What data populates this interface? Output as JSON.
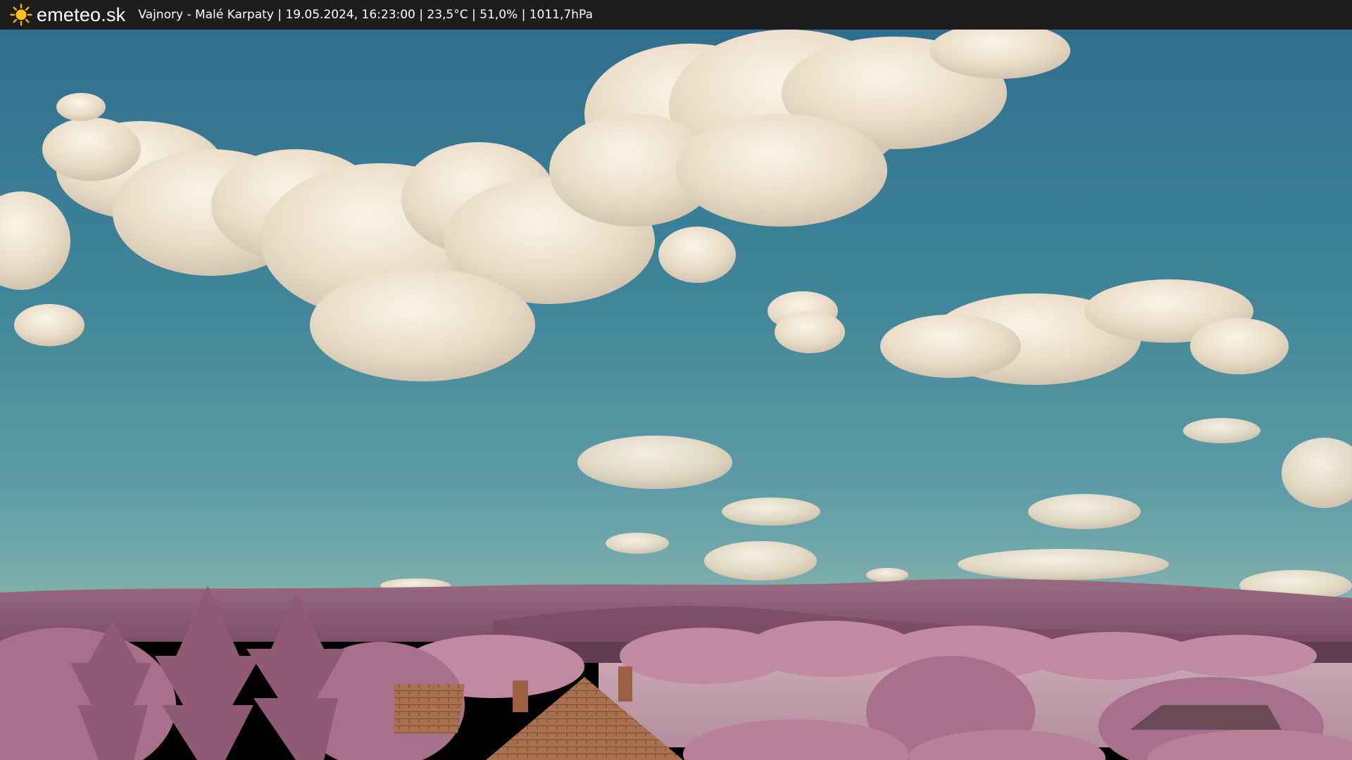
{
  "header": {
    "brand": "emeteo.sk",
    "logo_icon": "sun-icon",
    "location": "Vajnory - Malé Karpaty",
    "datetime": "19.05.2024, 16:23:00",
    "temperature": "23,5°C",
    "humidity": "51,0%",
    "pressure": "1011,7hPa",
    "info_line": "Vajnory - Malé Karpaty | 19.05.2024, 16:23:00 | 23,5°C | 51,0% | 1011,7hPa"
  },
  "colors": {
    "bar_background": "#1d1d1d",
    "sky_top": "#3c7f97",
    "sky_horizon": "#6fa7a9",
    "foliage": "#b9859a",
    "hills": "#8e5f78",
    "roof": "#b07a58"
  }
}
